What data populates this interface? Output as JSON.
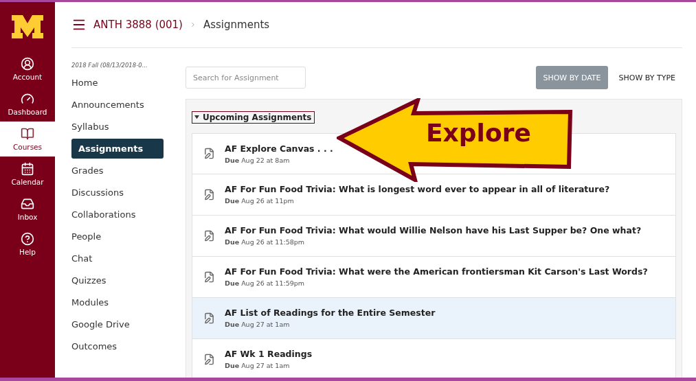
{
  "global_nav": [
    {
      "kind": "account",
      "label": "Account",
      "selected": false
    },
    {
      "kind": "dashboard",
      "label": "Dashboard",
      "selected": false
    },
    {
      "kind": "courses",
      "label": "Courses",
      "selected": true
    },
    {
      "kind": "calendar",
      "label": "Calendar",
      "selected": false
    },
    {
      "kind": "inbox",
      "label": "Inbox",
      "selected": false
    },
    {
      "kind": "help",
      "label": "Help",
      "selected": false
    }
  ],
  "breadcrumb": [
    "ANTH 3888 (001)",
    "Assignments"
  ],
  "course_nav": {
    "term": "2018 Fall (08/13/2018-0...",
    "items": [
      {
        "label": "Home",
        "selected": false
      },
      {
        "label": "Announcements",
        "selected": false
      },
      {
        "label": "Syllabus",
        "selected": false
      },
      {
        "label": "Assignments",
        "selected": true
      },
      {
        "label": "Grades",
        "selected": false
      },
      {
        "label": "Discussions",
        "selected": false
      },
      {
        "label": "Collaborations",
        "selected": false
      },
      {
        "label": "People",
        "selected": false
      },
      {
        "label": "Chat",
        "selected": false
      },
      {
        "label": "Quizzes",
        "selected": false
      },
      {
        "label": "Modules",
        "selected": false
      },
      {
        "label": "Google Drive",
        "selected": false
      },
      {
        "label": "Outcomes",
        "selected": false
      }
    ]
  },
  "search": {
    "placeholder": "Search for Assignment"
  },
  "view_buttons": [
    {
      "label": "SHOW BY DATE",
      "selected": true
    },
    {
      "label": "SHOW BY TYPE",
      "selected": false
    }
  ],
  "group": {
    "title": "Upcoming Assignments",
    "expanded": true
  },
  "assignments": [
    {
      "title": "AF Explore Canvas . . .",
      "due_label": "Due",
      "due": "Aug 22 at 8am",
      "highlighted": false
    },
    {
      "title": "AF For Fun Food Trivia: What is longest word ever to appear in all of literature?",
      "due_label": "Due",
      "due": "Aug 26 at 11pm",
      "highlighted": false
    },
    {
      "title": "AF For Fun Food Trivia: What would Willie Nelson have his Last Supper be? One what?",
      "due_label": "Due",
      "due": "Aug 26 at 11:58pm",
      "highlighted": false
    },
    {
      "title": "AF For Fun Food Trivia: What were the American frontiersman Kit Carson's Last Words?",
      "due_label": "Due",
      "due": "Aug 26 at 11:59pm",
      "highlighted": false
    },
    {
      "title": "AF List of Readings for the Entire Semester",
      "due_label": "Due",
      "due": "Aug 27 at 1am",
      "highlighted": true
    },
    {
      "title": "AF Wk 1 Readings",
      "due_label": "Due",
      "due": "Aug 27 at 1am",
      "highlighted": false
    }
  ],
  "callout": {
    "text": "Explore"
  }
}
